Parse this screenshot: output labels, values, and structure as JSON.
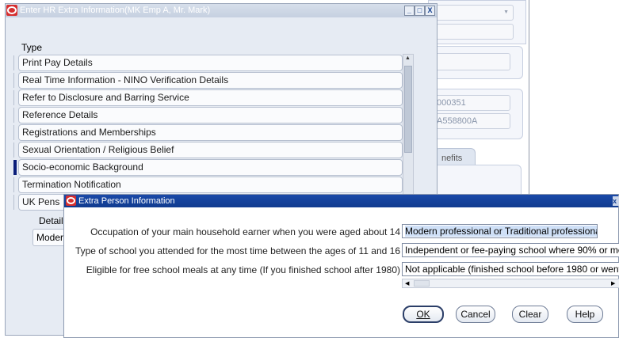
{
  "background": {
    "fields": [
      "",
      "",
      "",
      "000351",
      "A558800A"
    ],
    "tab_label": "nefits"
  },
  "hr_window": {
    "title": "Enter HR Extra Information(MK Emp A, Mr. Mark)",
    "column_header": "Type",
    "rows": [
      {
        "label": "Print Pay Details",
        "active": false
      },
      {
        "label": "Real Time Information - NINO Verification Details",
        "active": false
      },
      {
        "label": "Refer to Disclosure and Barring Service",
        "active": false
      },
      {
        "label": "Reference Details",
        "active": false
      },
      {
        "label": "Registrations and Memberships",
        "active": false
      },
      {
        "label": "Sexual Orientation / Religious Belief",
        "active": false
      },
      {
        "label": "Socio-economic Background",
        "active": true
      },
      {
        "label": "Termination Notification",
        "active": false
      },
      {
        "label": "UK Pens",
        "active": false
      }
    ],
    "details_label": "Detail",
    "details_value": "Moder",
    "win_buttons": [
      "_",
      "□",
      "X"
    ]
  },
  "dialog": {
    "title": "Extra Person Information",
    "fields": [
      {
        "label": "Occupation of your main household earner when you were aged about 14",
        "value": "Modern professional or Traditional professional"
      },
      {
        "label": "Type of school you attended for the most time between the ages of 11 and 16",
        "value": "Independent or fee-paying school where 90% or mo"
      },
      {
        "label": "Eligible for free school meals at any time (If you finished school after 1980)",
        "value": "Not applicable (finished school before 1980 or went"
      }
    ],
    "buttons": {
      "ok": "OK",
      "cancel": "Cancel",
      "clear": "Clear",
      "help": "Help"
    }
  }
}
